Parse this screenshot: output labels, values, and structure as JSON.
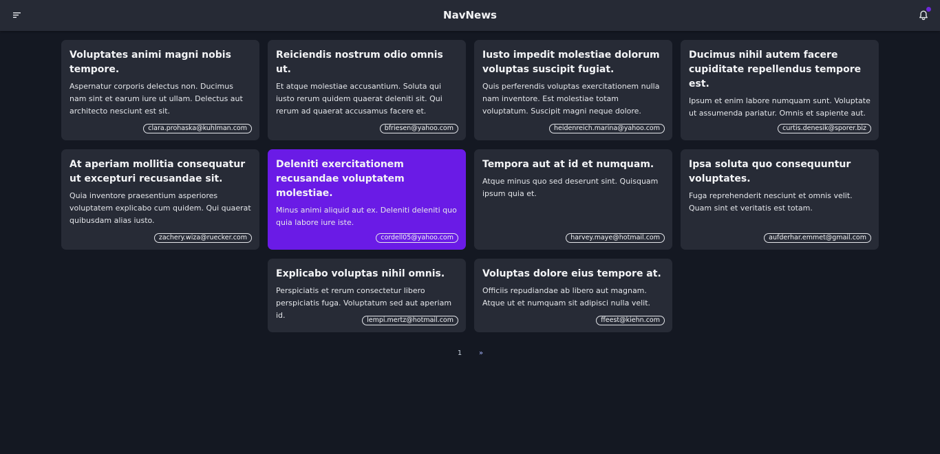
{
  "app": {
    "title": "NavNews"
  },
  "icons": {
    "menu": "menu-icon",
    "bell": "bell-icon",
    "accent": "#6a1be6"
  },
  "cards": [
    {
      "title": "Voluptates animi magni nobis tempore.",
      "body": "Aspernatur corporis delectus non. Ducimus nam sint et earum iure ut ullam. Delectus aut architecto nesciunt est sit.",
      "email": "clara.prohaska@kuhlman.com"
    },
    {
      "title": "Reiciendis nostrum odio omnis ut.",
      "body": "Et atque molestiae accusantium. Soluta qui iusto rerum quidem quaerat deleniti sit. Qui rerum ad quaerat accusamus facere et.",
      "email": "bfriesen@yahoo.com"
    },
    {
      "title": "Iusto impedit molestiae dolorum voluptas suscipit fugiat.",
      "body": "Quis perferendis voluptas exercitationem nulla nam inventore. Est molestiae totam voluptatum. Suscipit magni neque dolore.",
      "email": "heidenreich.marina@yahoo.com"
    },
    {
      "title": "Ducimus nihil autem facere cupiditate repellendus tempore est.",
      "body": "Ipsum et enim labore numquam sunt. Voluptate ut assumenda pariatur. Omnis et sapiente aut.",
      "email": "curtis.denesik@sporer.biz"
    },
    {
      "title": "At aperiam mollitia consequatur ut excepturi recusandae sit.",
      "body": "Quia inventore praesentium asperiores voluptatem explicabo cum quidem. Qui quaerat quibusdam alias iusto.",
      "email": "zachery.wiza@ruecker.com"
    },
    {
      "title": "Deleniti exercitationem recusandae voluptatem molestiae.",
      "body": "Minus animi aliquid aut ex. Deleniti deleniti quo quia labore iure iste.",
      "email": "cordell05@yahoo.com"
    },
    {
      "title": "Tempora aut at id et numquam.",
      "body": "Atque minus quo sed deserunt sint. Quisquam ipsum quia et.",
      "email": "harvey.maye@hotmail.com"
    },
    {
      "title": "Ipsa soluta quo consequuntur voluptates.",
      "body": "Fuga reprehenderit nesciunt et omnis velit. Quam sint et veritatis est totam.",
      "email": "aufderhar.emmet@gmail.com"
    },
    {
      "title": "Explicabo voluptas nihil omnis.",
      "body": "Perspiciatis et rerum consectetur libero perspiciatis fuga. Voluptatum sed aut aperiam id.",
      "email": "lempi.mertz@hotmail.com"
    },
    {
      "title": "Voluptas dolore eius tempore at.",
      "body": "Officiis repudiandae ab libero aut magnam. Atque ut et numquam sit adipisci nulla velit.",
      "email": "ffeest@kiehn.com"
    }
  ],
  "pagination": {
    "current": "1",
    "next": "»"
  }
}
